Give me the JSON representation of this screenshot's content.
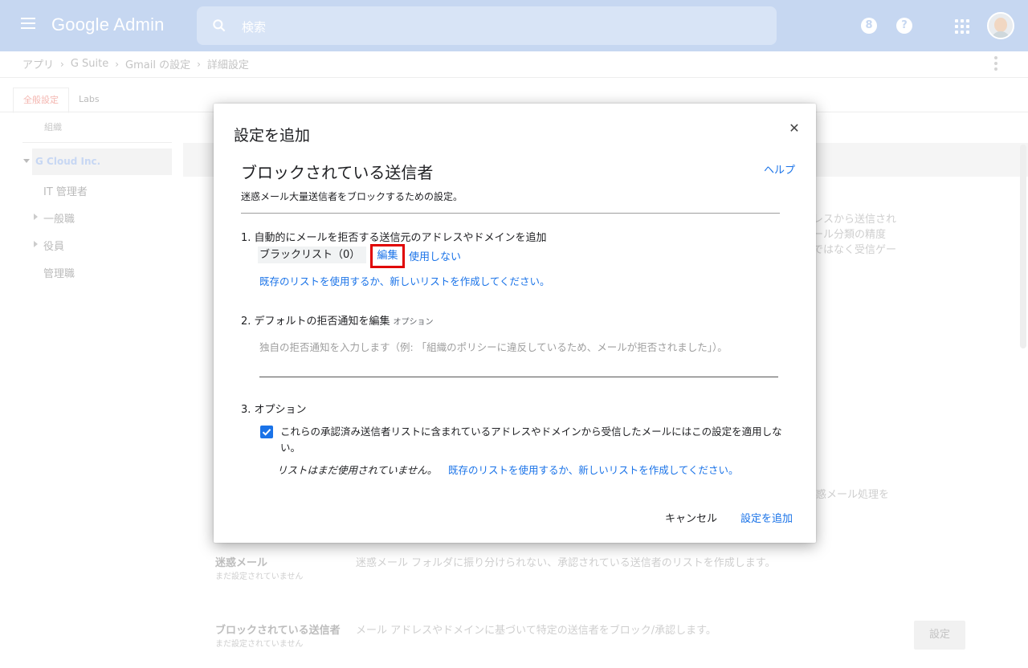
{
  "header": {
    "logo": "Google Admin",
    "search_placeholder": "検索",
    "notif_glyph": "8",
    "help_glyph": "?"
  },
  "breadcrumb": [
    "アプリ",
    "G Suite",
    "Gmail の設定",
    "詳細設定"
  ],
  "tabs": [
    "全般設定",
    "Labs"
  ],
  "org": {
    "header": "組織",
    "root": "G Cloud Inc.",
    "items": [
      "IT 管理者",
      "一般職",
      "役員",
      "管理職"
    ]
  },
  "background": {
    "partial_lines": [
      "レスから送信され",
      "ール分類の精度",
      "ではなく受信ゲー"
    ],
    "partial_line4": "惑メール処理を",
    "rows": [
      {
        "title": "迷惑メール",
        "status": "まだ設定されていません",
        "description": "迷惑メール フォルダに振り分けられない、承認されている送信者のリストを作成します。"
      },
      {
        "title": "ブロックされている送信者",
        "status": "まだ設定されていません",
        "description": "メール アドレスやドメインに基づいて特定の送信者をブロック/承認します。",
        "button": "設定"
      }
    ]
  },
  "modal": {
    "title": "設定を追加",
    "heading": "ブロックされている送信者",
    "help": "ヘルプ",
    "description": "迷惑メール大量送信者をブロックするための設定。",
    "section1": {
      "label": "1. 自動的にメールを拒否する送信元のアドレスやドメインを追加",
      "blacklist": "ブラックリスト（0）",
      "edit": "編集",
      "no_use": "使用しない",
      "link": "既存のリストを使用するか、新しいリストを作成してください。"
    },
    "section2": {
      "label": "2. デフォルトの拒否通知を編集",
      "option_tag": "オプション",
      "placeholder": "独自の拒否通知を入力します（例: 「組織のポリシーに違反しているため、メールが拒否されました」）。"
    },
    "section3": {
      "label": "3. オプション",
      "checkbox_text": "これらの承認済み送信者リストに含まれているアドレスやドメインから受信したメールにはこの設定を適用しない。",
      "checked": true,
      "no_list": "リストはまだ使用されていません。",
      "link": "既存のリストを使用するか、新しいリストを作成してください。"
    },
    "cancel": "キャンセル",
    "add": "設定を追加"
  },
  "colors": {
    "header_bg": "#c6d7f1",
    "link": "#1a73e8",
    "highlight": "#e00000"
  }
}
